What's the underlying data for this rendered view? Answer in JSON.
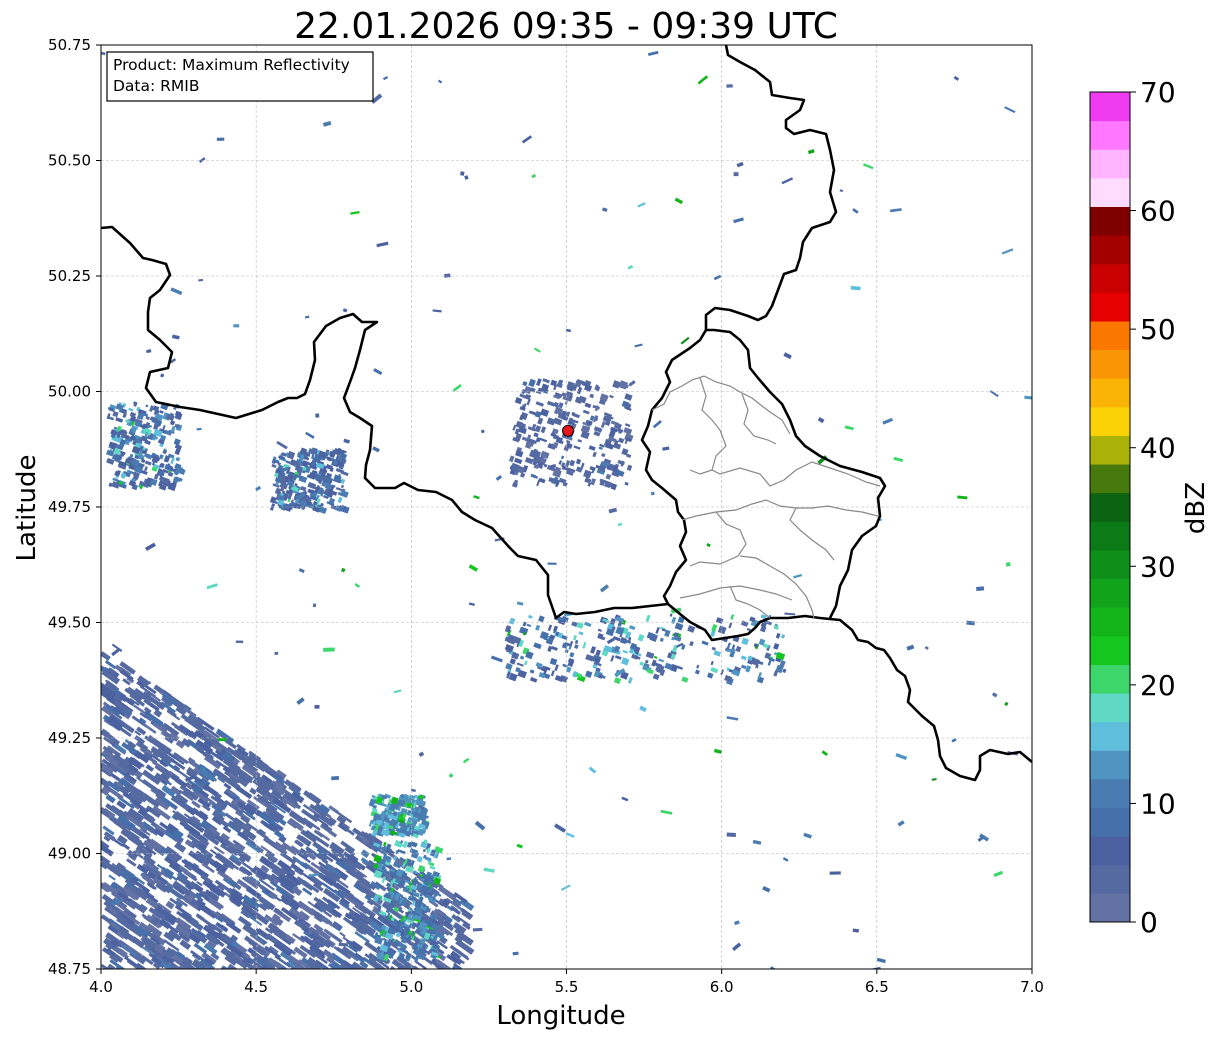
{
  "title": "22.01.2026 09:35 - 09:39 UTC",
  "info_box": {
    "line1": "Product: Maximum Reflectivity",
    "line2": "Data: RMIB"
  },
  "chart_data": {
    "type": "heatmap",
    "title": "22.01.2026 09:35 - 09:39 UTC",
    "xlabel": "Longitude",
    "ylabel": "Latitude",
    "xlim": [
      4.0,
      7.0
    ],
    "ylim": [
      48.75,
      50.75
    ],
    "x_ticks": [
      "4.0",
      "4.5",
      "5.0",
      "5.5",
      "6.0",
      "6.5",
      "7.0"
    ],
    "y_ticks": [
      "48.75",
      "49.00",
      "49.25",
      "49.50",
      "49.75",
      "50.00",
      "50.25",
      "50.50",
      "50.75"
    ],
    "grid": true,
    "radar_site": {
      "lon": 5.505,
      "lat": 49.915,
      "marker_color": "#e8141c"
    },
    "colorbar": {
      "label": "dBZ",
      "range": [
        0,
        70
      ],
      "ticks": [
        "0",
        "10",
        "20",
        "30",
        "40",
        "50",
        "60",
        "70"
      ],
      "colors": [
        "#6272a4",
        "#566aa2",
        "#4b61a0",
        "#4570aa",
        "#4a7cb2",
        "#5095c2",
        "#5fbedb",
        "#5fd8c4",
        "#3dd66a",
        "#15c620",
        "#13b51a",
        "#11a41a",
        "#0f8e1a",
        "#0c7a16",
        "#0a6412",
        "#467a0c",
        "#aab20a",
        "#fad205",
        "#fab405",
        "#fa9605",
        "#fa7800",
        "#e60000",
        "#c80000",
        "#a50000",
        "#800000",
        "#ffdcff",
        "#ffb4ff",
        "#ff78ff",
        "#f03cf0"
      ]
    },
    "echo_regions": [
      {
        "name": "southwest-stratiform",
        "dbz": [
          2,
          12
        ],
        "bounds_lon": [
          4.0,
          5.17
        ],
        "bounds_lat": [
          48.75,
          49.45
        ]
      },
      {
        "name": "cell-4.95-49.10",
        "dbz": [
          10,
          28
        ],
        "bounds_lon": [
          4.87,
          5.04
        ],
        "bounds_lat": [
          49.05,
          49.13
        ]
      },
      {
        "name": "cell-4.98-48.95",
        "dbz": [
          8,
          28
        ],
        "bounds_lon": [
          4.88,
          5.08
        ],
        "bounds_lat": [
          48.78,
          49.03
        ]
      },
      {
        "name": "cells-4.1-49.95",
        "dbz": [
          4,
          24
        ],
        "bounds_lon": [
          4.02,
          4.25
        ],
        "bounds_lat": [
          49.8,
          49.98
        ]
      },
      {
        "name": "cell-4.68-49.80",
        "dbz": [
          4,
          22
        ],
        "bounds_lon": [
          4.55,
          4.78
        ],
        "bounds_lat": [
          49.75,
          49.88
        ]
      },
      {
        "name": "ground-clutter-radar",
        "dbz": [
          2,
          10
        ],
        "bounds_lon": [
          5.32,
          5.7
        ],
        "bounds_lat": [
          49.8,
          50.03
        ]
      },
      {
        "name": "arc-south",
        "dbz": [
          4,
          30
        ],
        "bounds_lon": [
          5.3,
          6.2
        ],
        "bounds_lat": [
          49.38,
          49.52
        ]
      }
    ]
  }
}
